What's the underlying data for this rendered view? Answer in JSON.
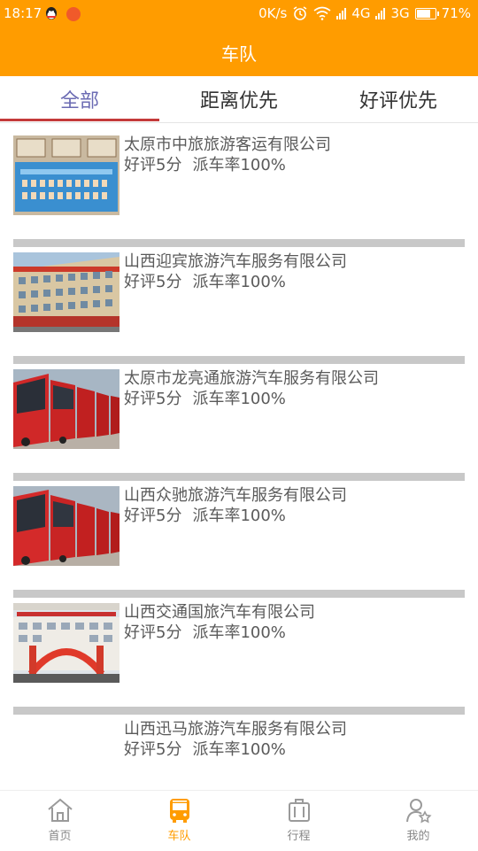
{
  "status_bar": {
    "time": "18:17",
    "net_speed": "0K/s",
    "net1": "4G",
    "net2": "3G",
    "battery": "71%",
    "icons": [
      "qq-icon",
      "notification-icon",
      "alarm-icon",
      "wifi-icon",
      "signal-icon",
      "battery-icon"
    ]
  },
  "header": {
    "title": "车队"
  },
  "tabs": [
    {
      "label": "全部",
      "active": true
    },
    {
      "label": "距离优先",
      "active": false
    },
    {
      "label": "好评优先",
      "active": false
    }
  ],
  "companies": [
    {
      "name": "太原市中旅旅游客运有限公司",
      "rating": "好评5分",
      "dispatch": "派车率100%"
    },
    {
      "name": "山西迎宾旅游汽车服务有限公司",
      "rating": "好评5分",
      "dispatch": "派车率100%"
    },
    {
      "name": "太原市龙亮通旅游汽车服务有限公司",
      "rating": "好评5分",
      "dispatch": "派车率100%"
    },
    {
      "name": "山西众驰旅游汽车服务有限公司",
      "rating": "好评5分",
      "dispatch": "派车率100%"
    },
    {
      "name": "山西交通国旅汽车有限公司",
      "rating": "好评5分",
      "dispatch": "派车率100%"
    },
    {
      "name": "山西迅马旅游汽车服务有限公司",
      "rating": "好评5分",
      "dispatch": "派车率100%"
    }
  ],
  "bottom_nav": [
    {
      "label": "首页",
      "icon": "home-icon",
      "active": false
    },
    {
      "label": "车队",
      "icon": "bus-icon",
      "active": true
    },
    {
      "label": "行程",
      "icon": "luggage-icon",
      "active": false
    },
    {
      "label": "我的",
      "icon": "user-icon",
      "active": false
    }
  ],
  "colors": {
    "accent": "#FF9C00",
    "tab_active": "#6b6bb3",
    "tab_underline": "#c43a3a"
  }
}
